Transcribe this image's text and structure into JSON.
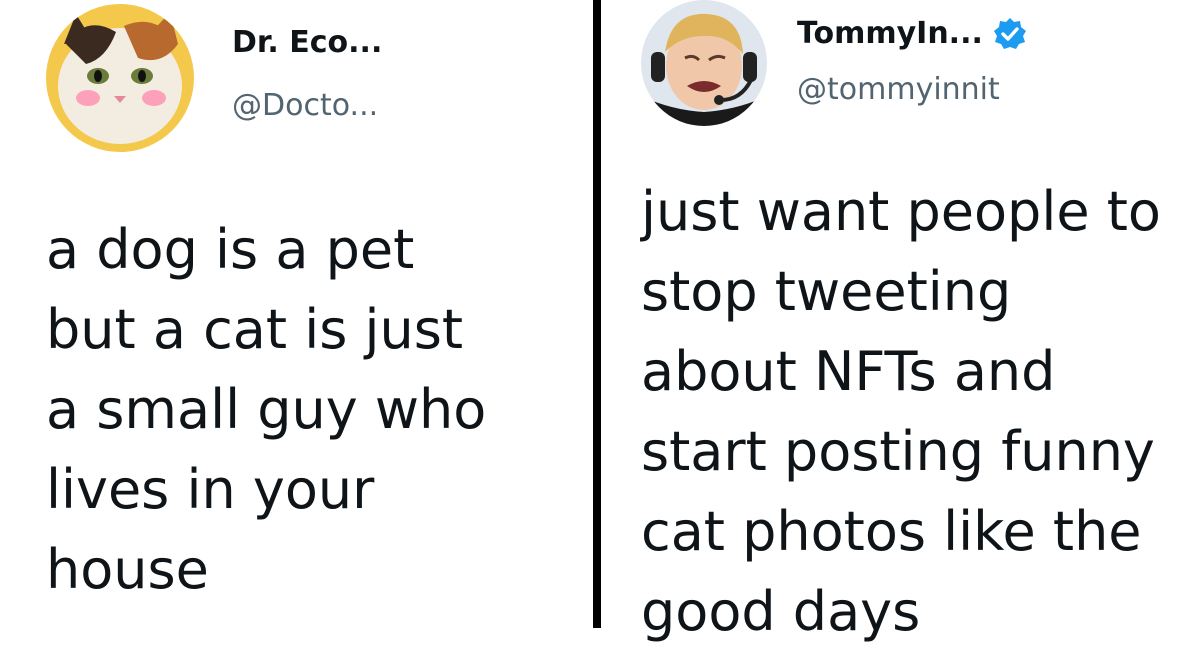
{
  "tweets": [
    {
      "display_name": "Dr. Eco...",
      "handle": "@Docto...",
      "text": "a dog is a pet\nbut a cat is just\na small guy who\nlives in your\nhouse"
    },
    {
      "display_name": "TommyIn...",
      "handle": "@tommyinnit",
      "verified": true,
      "text": "just want people to\nstop tweeting\nabout NFTs and\nstart posting funny\ncat photos like the\ngood days"
    }
  ],
  "colors": {
    "text": "#0f1419",
    "handle": "#536471",
    "verified_badge": "#1d9bf0",
    "divider": "#000000"
  }
}
